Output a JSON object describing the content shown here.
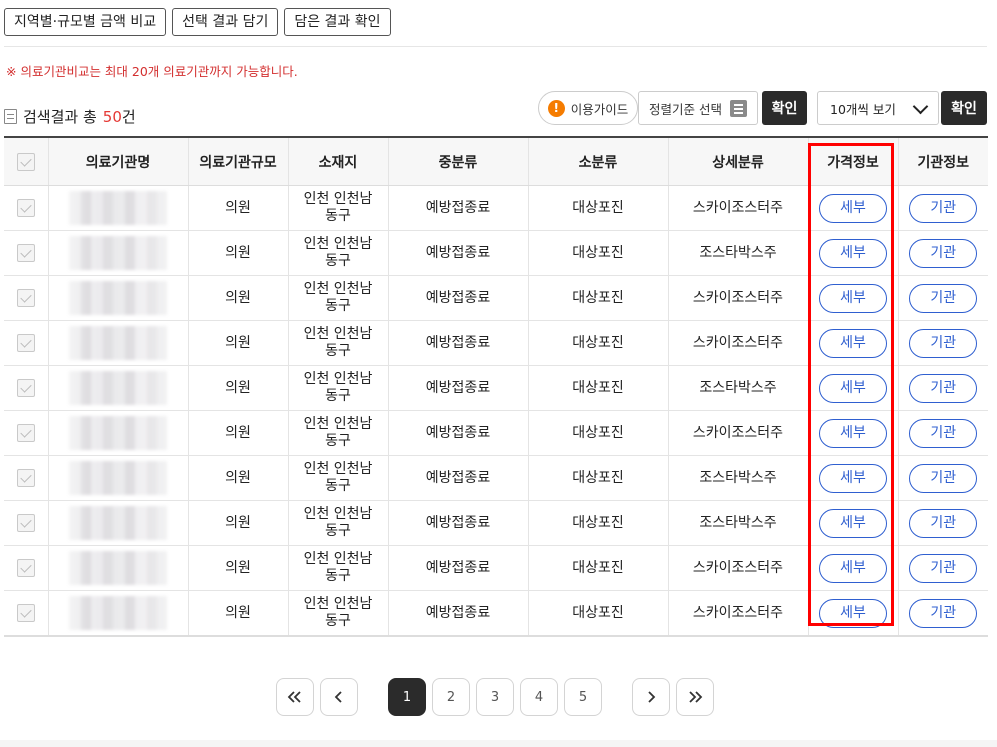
{
  "top_buttons": {
    "region_compare": "지역별·규모별 금액 비교",
    "add_selection": "선택 결과 담기",
    "check_saved": "담은 결과 확인"
  },
  "notice": "※ 의료기관비교는 최대 20개 의료기관까지 가능합니다.",
  "summary": {
    "prefix": "검색결과 총",
    "count": "50",
    "suffix": "건"
  },
  "toolbar": {
    "guide_label": "이용가이드",
    "sort_label": "정렬기준 선택",
    "confirm_label": "확인",
    "per_page_selected": "10개씩 보기",
    "per_page_confirm": "확인"
  },
  "table": {
    "headers": [
      "의료기관명",
      "의료기관규모",
      "소재지",
      "중분류",
      "소분류",
      "상세분류",
      "가격정보",
      "기관정보"
    ],
    "rows": [
      {
        "size": "의원",
        "loc1": "인천 인천남",
        "loc2": "동구",
        "mid": "예방접종료",
        "sub": "대상포진",
        "detail": "스카이조스터주",
        "price_btn": "세부",
        "inst_btn": "기관"
      },
      {
        "size": "의원",
        "loc1": "인천 인천남",
        "loc2": "동구",
        "mid": "예방접종료",
        "sub": "대상포진",
        "detail": "조스타박스주",
        "price_btn": "세부",
        "inst_btn": "기관"
      },
      {
        "size": "의원",
        "loc1": "인천 인천남",
        "loc2": "동구",
        "mid": "예방접종료",
        "sub": "대상포진",
        "detail": "스카이조스터주",
        "price_btn": "세부",
        "inst_btn": "기관"
      },
      {
        "size": "의원",
        "loc1": "인천 인천남",
        "loc2": "동구",
        "mid": "예방접종료",
        "sub": "대상포진",
        "detail": "스카이조스터주",
        "price_btn": "세부",
        "inst_btn": "기관"
      },
      {
        "size": "의원",
        "loc1": "인천 인천남",
        "loc2": "동구",
        "mid": "예방접종료",
        "sub": "대상포진",
        "detail": "조스타박스주",
        "price_btn": "세부",
        "inst_btn": "기관"
      },
      {
        "size": "의원",
        "loc1": "인천 인천남",
        "loc2": "동구",
        "mid": "예방접종료",
        "sub": "대상포진",
        "detail": "스카이조스터주",
        "price_btn": "세부",
        "inst_btn": "기관"
      },
      {
        "size": "의원",
        "loc1": "인천 인천남",
        "loc2": "동구",
        "mid": "예방접종료",
        "sub": "대상포진",
        "detail": "조스타박스주",
        "price_btn": "세부",
        "inst_btn": "기관"
      },
      {
        "size": "의원",
        "loc1": "인천 인천남",
        "loc2": "동구",
        "mid": "예방접종료",
        "sub": "대상포진",
        "detail": "조스타박스주",
        "price_btn": "세부",
        "inst_btn": "기관"
      },
      {
        "size": "의원",
        "loc1": "인천 인천남",
        "loc2": "동구",
        "mid": "예방접종료",
        "sub": "대상포진",
        "detail": "스카이조스터주",
        "price_btn": "세부",
        "inst_btn": "기관"
      },
      {
        "size": "의원",
        "loc1": "인천 인천남",
        "loc2": "동구",
        "mid": "예방접종료",
        "sub": "대상포진",
        "detail": "스카이조스터주",
        "price_btn": "세부",
        "inst_btn": "기관"
      }
    ]
  },
  "pagination": {
    "pages": [
      "1",
      "2",
      "3",
      "4",
      "5"
    ],
    "current": "1"
  },
  "colors": {
    "accent_blue": "#2f5fd0",
    "highlight_red": "#ff0000",
    "notice_red": "#d32f2f",
    "dark_button": "#2b2b2b"
  }
}
